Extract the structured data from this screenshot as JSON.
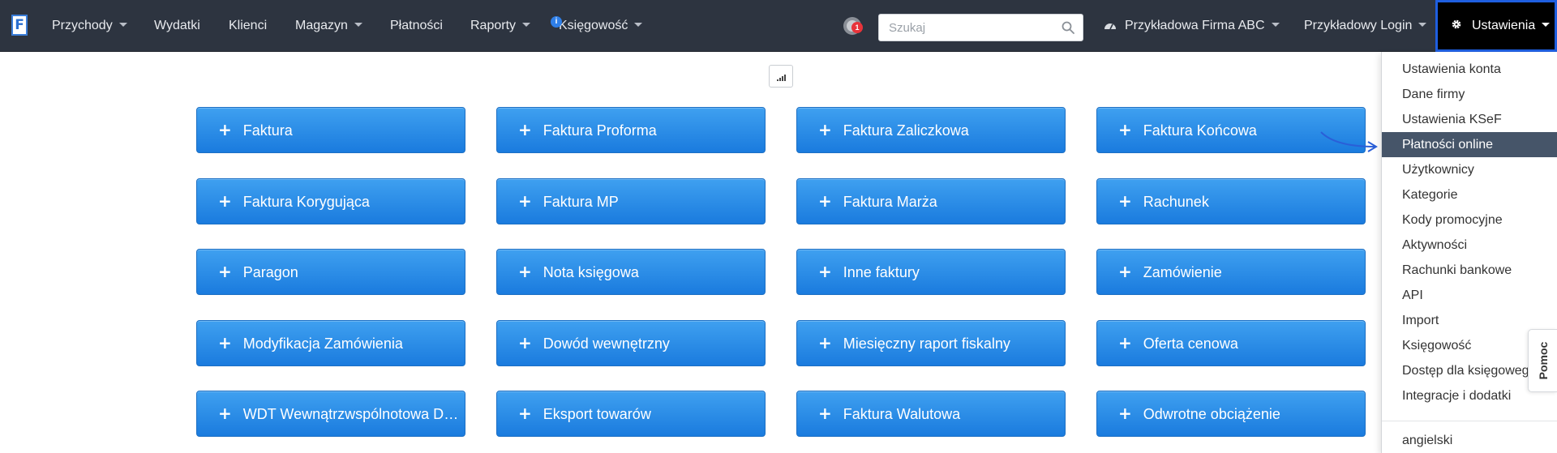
{
  "navbar": {
    "logo": "F",
    "items": [
      {
        "label": "Przychody",
        "dropdown": true
      },
      {
        "label": "Wydatki",
        "dropdown": false
      },
      {
        "label": "Klienci",
        "dropdown": false
      },
      {
        "label": "Magazyn",
        "dropdown": true
      },
      {
        "label": "Płatności",
        "dropdown": false
      },
      {
        "label": "Raporty",
        "dropdown": true
      },
      {
        "label": "Księgowość",
        "dropdown": true,
        "badge": "i"
      }
    ],
    "notification_count": "1",
    "search_placeholder": "Szukaj",
    "company": "Przykładowa Firma ABC",
    "login": "Przykładowy Login",
    "settings": "Ustawienia"
  },
  "documents": [
    [
      "Faktura",
      "Faktura Proforma",
      "Faktura Zaliczkowa",
      "Faktura Końcowa"
    ],
    [
      "Faktura Korygująca",
      "Faktura MP",
      "Faktura Marża",
      "Rachunek"
    ],
    [
      "Paragon",
      "Nota księgowa",
      "Inne faktury",
      "Zamówienie"
    ],
    [
      "Modyfikacja Zamówienia",
      "Dowód wewnętrzny",
      "Miesięczny raport fiskalny",
      "Oferta cenowa"
    ],
    [
      "WDT Wewnątrzwspólnotowa Dostawa Towarów",
      "Eksport towarów",
      "Faktura Walutowa",
      "Odwrotne obciążenie"
    ]
  ],
  "settings_menu": {
    "items": [
      "Ustawienia konta",
      "Dane firmy",
      "Ustawienia KSeF",
      "Płatności online",
      "Użytkownicy",
      "Kategorie",
      "Kody promocyjne",
      "Aktywności",
      "Rachunki bankowe",
      "API",
      "Import",
      "Księgowość",
      "Dostęp dla księgowego",
      "Integracje i dodatki"
    ],
    "active_item": "Płatności online",
    "language": "angielski"
  },
  "help_tab": "Pomoc",
  "colors": {
    "navbar": "#2d3440",
    "button_blue": "#1a7bde",
    "active_menu": "#465569",
    "highlight_border": "#1f5fe0"
  }
}
